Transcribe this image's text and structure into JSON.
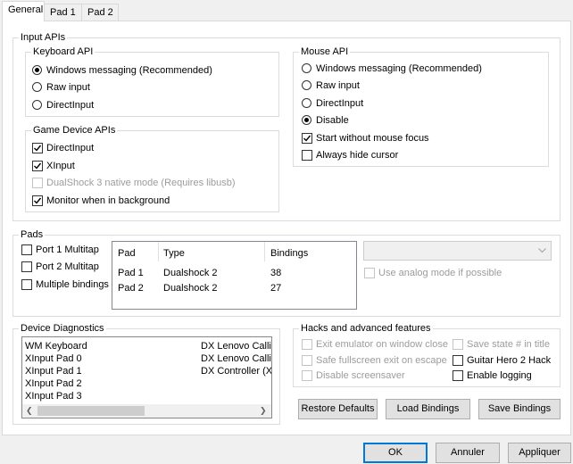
{
  "tabs": [
    {
      "label": "General"
    },
    {
      "label": "Pad 1"
    },
    {
      "label": "Pad 2"
    }
  ],
  "input_apis": {
    "title": "Input APIs",
    "keyboard": {
      "title": "Keyboard API",
      "options": [
        "Windows messaging (Recommended)",
        "Raw input",
        "DirectInput"
      ],
      "selected": "Windows messaging (Recommended)"
    },
    "mouse": {
      "title": "Mouse API",
      "options": [
        "Windows messaging (Recommended)",
        "Raw input",
        "DirectInput",
        "Disable"
      ],
      "selected": "Disable",
      "start_without_focus": "Start without mouse focus",
      "always_hide_cursor": "Always hide cursor"
    },
    "game_device": {
      "title": "Game Device APIs",
      "directinput": "DirectInput",
      "xinput": "XInput",
      "dualshock3": "DualShock 3 native mode (Requires libusb)",
      "monitor_bg": "Monitor when in background"
    }
  },
  "pads": {
    "title": "Pads",
    "port1_multitap": "Port 1 Multitap",
    "port2_multitap": "Port 2 Multitap",
    "multiple_bindings": "Multiple bindings",
    "columns": [
      "Pad",
      "Type",
      "Bindings"
    ],
    "rows": [
      {
        "pad": "Pad 1",
        "type": "Dualshock 2",
        "bindings": "38"
      },
      {
        "pad": "Pad 2",
        "type": "Dualshock 2",
        "bindings": "27"
      }
    ],
    "analog_mode": "Use analog mode if possible"
  },
  "diagnostics": {
    "title": "Device Diagnostics",
    "left_items": [
      "WM Keyboard",
      "XInput Pad 0",
      "XInput Pad 1",
      "XInput Pad 2",
      "XInput Pad 3"
    ],
    "right_items": [
      "DX Lenovo Callic",
      "DX Lenovo Callic",
      "DX Controller (XI"
    ]
  },
  "hacks": {
    "title": "Hacks and advanced features",
    "exit_on_close": "Exit emulator on window close",
    "safe_fullscreen": "Safe fullscreen exit on escape",
    "disable_screensaver": "Disable screensaver",
    "save_state_title": "Save state # in title",
    "guitar_hero": "Guitar Hero 2 Hack",
    "enable_logging": "Enable logging"
  },
  "buttons": {
    "restore_defaults": "Restore Defaults",
    "load_bindings": "Load Bindings",
    "save_bindings": "Save Bindings",
    "ok": "OK",
    "cancel": "Annuler",
    "apply": "Appliquer"
  }
}
